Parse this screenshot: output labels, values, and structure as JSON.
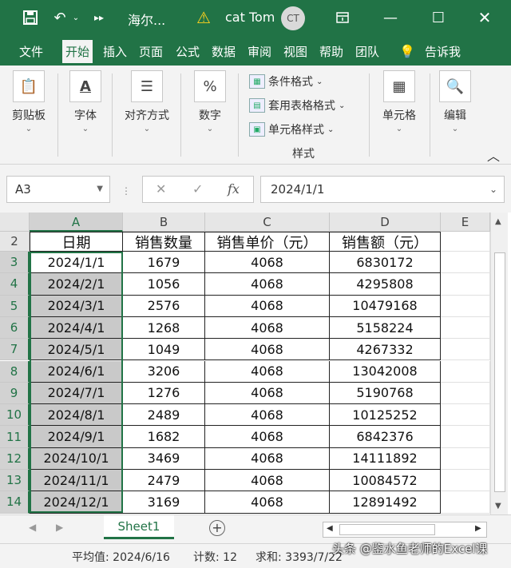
{
  "titlebar": {
    "save_icon": "save-icon",
    "undo_icon": "undo-icon",
    "title": "海尔...",
    "user": "cat Tom",
    "avatar": "CT"
  },
  "tabs": [
    "文件",
    "开始",
    "插入",
    "页面",
    "公式",
    "数据",
    "审阅",
    "视图",
    "帮助",
    "团队",
    "告诉我"
  ],
  "active_tab": "开始",
  "ribbon": {
    "clipboard": "剪贴板",
    "font": "字体",
    "align": "对齐方式",
    "number": "数字",
    "cond_format": "条件格式",
    "table_format": "套用表格格式",
    "cell_style": "单元格样式",
    "styles_group": "样式",
    "cells": "单元格",
    "edit": "编辑"
  },
  "formula_bar": {
    "name_box": "A3",
    "fx": "fx",
    "value": "2024/1/1"
  },
  "columns": [
    "A",
    "B",
    "C",
    "D",
    "E"
  ],
  "table": {
    "headers": [
      "日期",
      "销售数量",
      "销售单价（元）",
      "销售额（元）"
    ],
    "rows": [
      {
        "n": "3",
        "cells": [
          "2024/1/1",
          "1679",
          "4068",
          "6830172"
        ]
      },
      {
        "n": "4",
        "cells": [
          "2024/2/1",
          "1056",
          "4068",
          "4295808"
        ]
      },
      {
        "n": "5",
        "cells": [
          "2024/3/1",
          "2576",
          "4068",
          "10479168"
        ]
      },
      {
        "n": "6",
        "cells": [
          "2024/4/1",
          "1268",
          "4068",
          "5158224"
        ]
      },
      {
        "n": "7",
        "cells": [
          "2024/5/1",
          "1049",
          "4068",
          "4267332"
        ]
      },
      {
        "n": "8",
        "cells": [
          "2024/6/1",
          "3206",
          "4068",
          "13042008"
        ]
      },
      {
        "n": "9",
        "cells": [
          "2024/7/1",
          "1276",
          "4068",
          "5190768"
        ]
      },
      {
        "n": "10",
        "cells": [
          "2024/8/1",
          "2489",
          "4068",
          "10125252"
        ]
      },
      {
        "n": "11",
        "cells": [
          "2024/9/1",
          "1682",
          "4068",
          "6842376"
        ]
      },
      {
        "n": "12",
        "cells": [
          "2024/10/1",
          "3469",
          "4068",
          "14111892"
        ]
      },
      {
        "n": "13",
        "cells": [
          "2024/11/1",
          "2479",
          "4068",
          "10084572"
        ]
      },
      {
        "n": "14",
        "cells": [
          "2024/12/1",
          "3169",
          "4068",
          "12891492"
        ]
      }
    ]
  },
  "header_row_num": "2",
  "sheet_tab": "Sheet1",
  "status": {
    "average": "平均值: 2024/6/16",
    "count": "计数: 12",
    "sum": "求和: 3393/7/22"
  },
  "watermark": "头条 @鉴水鱼老师的Excel课",
  "colors": {
    "accent": "#217346",
    "selection": "#c9c9c9"
  }
}
